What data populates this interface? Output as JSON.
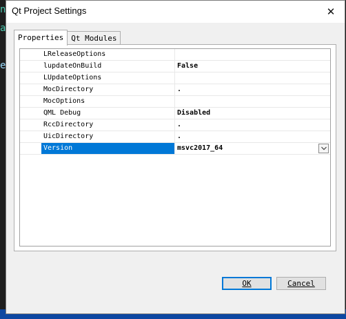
{
  "dialog": {
    "title": "Qt Project Settings",
    "close_glyph": "✕"
  },
  "tabs": [
    {
      "label": "Properties",
      "active": true
    },
    {
      "label": "Qt Modules",
      "active": false
    }
  ],
  "properties": [
    {
      "name": "LReleaseOptions",
      "value": ""
    },
    {
      "name": "lupdateOnBuild",
      "value": "False"
    },
    {
      "name": "LUpdateOptions",
      "value": ""
    },
    {
      "name": "MocDirectory",
      "value": "."
    },
    {
      "name": "MocOptions",
      "value": ""
    },
    {
      "name": "QML Debug",
      "value": "Disabled"
    },
    {
      "name": "RccDirectory",
      "value": "."
    },
    {
      "name": "UicDirectory",
      "value": "."
    },
    {
      "name": "Version",
      "value": "msvc2017_64",
      "selected": true
    }
  ],
  "buttons": {
    "ok_label": "OK",
    "cancel_label": "Cancel"
  },
  "background_glyphs": [
    "n",
    "a",
    "e"
  ],
  "colors": {
    "selection": "#0078d7",
    "default_button_border": "#0078d7",
    "taskbar": "#0d47a1"
  },
  "icons": {
    "dropdown": "chevron-down-icon",
    "close": "close-icon"
  }
}
